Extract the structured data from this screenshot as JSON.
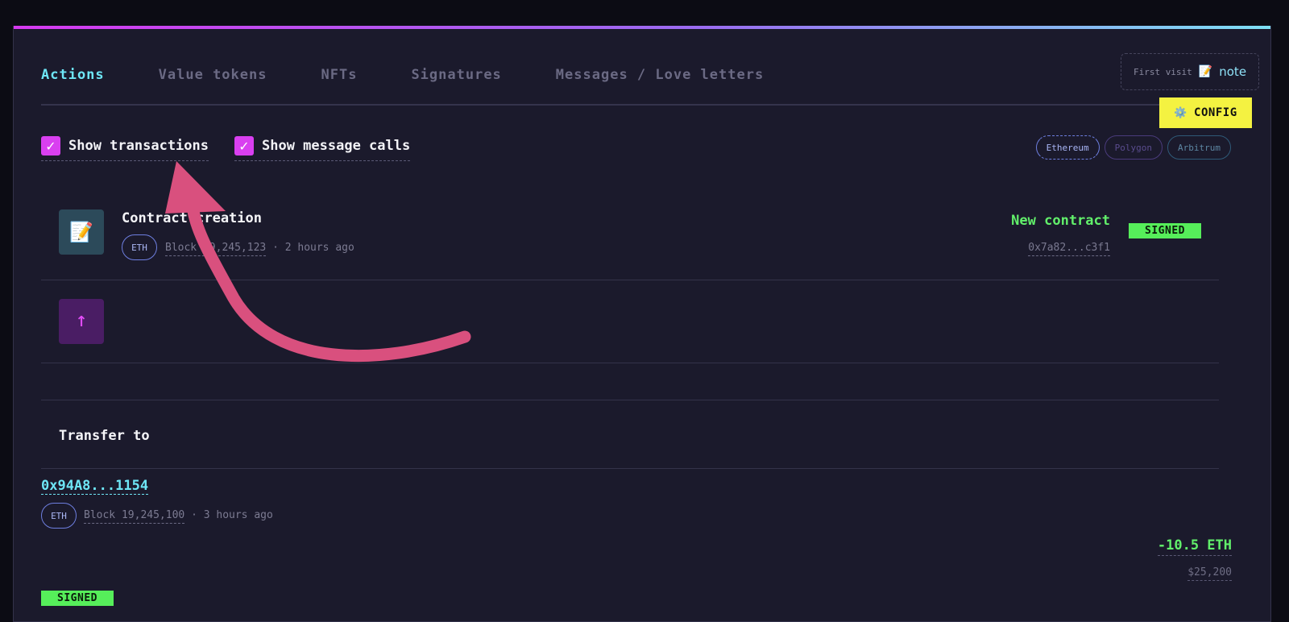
{
  "tabs": [
    {
      "label": "Actions"
    },
    {
      "label": "Value tokens"
    },
    {
      "label": "NFTs"
    },
    {
      "label": "Signatures"
    },
    {
      "label": "Messages / Love letters"
    }
  ],
  "first_visit": {
    "label": "First visit",
    "icon": "📝",
    "link": "note"
  },
  "config": {
    "icon": "⚙️",
    "label": "CONFIG"
  },
  "filters": {
    "show_transactions": {
      "label": "Show transactions",
      "checked": true
    },
    "show_message_calls": {
      "label": "Show message calls",
      "checked": true
    }
  },
  "chains": [
    {
      "label": "Ethereum"
    },
    {
      "label": "Polygon"
    },
    {
      "label": "Arbitrum"
    }
  ],
  "rows": [
    {
      "icon": "📝",
      "title": "Contract creation",
      "chain": "ETH",
      "block": "Block 19,245,123",
      "age": "· 2 hours ago",
      "status": "New contract",
      "hash": "0x7a82...c3f1",
      "badge": "SIGNED"
    },
    {
      "icon": "↑"
    }
  ],
  "transfer": {
    "title": "Transfer to",
    "address": "0x94A8...1154",
    "chain": "ETH",
    "block": "Block 19,245,100",
    "age": "· 3 hours ago",
    "amount": "-10.5 ETH",
    "usd": "$25,200",
    "badge": "SIGNED"
  },
  "colors": {
    "accent_cyan": "#6ee6f6",
    "accent_magenta": "#d93ff0",
    "success_green": "#62f06b",
    "config_yellow": "#f4f241",
    "annotation_arrow": "#d9507e"
  }
}
